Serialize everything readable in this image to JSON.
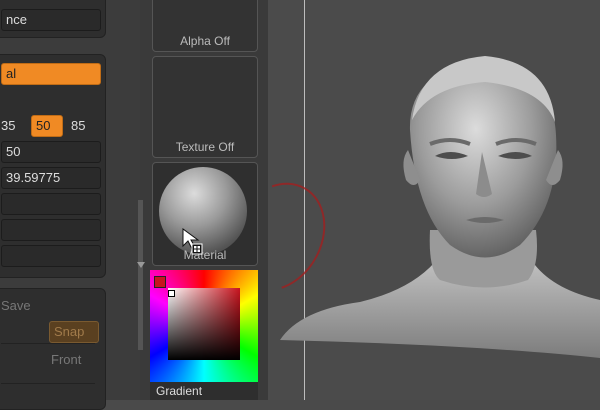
{
  "left": {
    "top_label": "nce",
    "material_field": "al",
    "numbers": {
      "n35": "35",
      "n50": "50",
      "n85": "85"
    },
    "value_50": "50",
    "value_decimal": "39.59775",
    "bottom": {
      "save": "Save",
      "snap": "Snap",
      "front": "Front"
    }
  },
  "tiles": {
    "alpha": "Alpha Off",
    "texture": "Texture Off",
    "material": "Material",
    "gradient": "Gradient"
  },
  "colors": {
    "accent": "#f08a24",
    "panel": "#3c3c3c",
    "canvas": "#4b4b4b"
  }
}
